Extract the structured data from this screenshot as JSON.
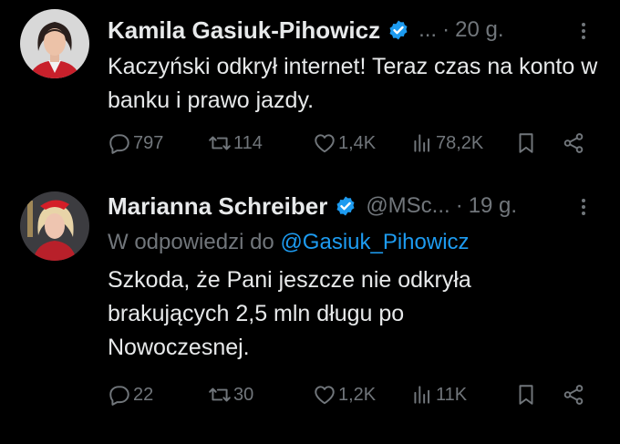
{
  "tweets": [
    {
      "author_name": "Kamila Gasiuk-Pihowicz",
      "handle": "...",
      "time": "20 g.",
      "text": "Kaczyński odkrył internet! Teraz czas na konto w banku i prawo jazdy.",
      "stats": {
        "replies": "797",
        "reposts": "114",
        "likes": "1,4K",
        "views": "78,2K"
      }
    },
    {
      "author_name": "Marianna Schreiber",
      "handle": "@MSc...",
      "time": "19 g.",
      "reply_prefix": "W odpowiedzi do",
      "reply_mention": "@Gasiuk_Pihowicz",
      "text": "Szkoda, że Pani jeszcze nie odkryła brakujących 2,5 mln długu po Nowoczesnej.",
      "stats": {
        "replies": "22",
        "reposts": "30",
        "likes": "1,2K",
        "views": "11K"
      }
    }
  ],
  "colors": {
    "background": "#000000",
    "text": "#e7e9ea",
    "muted": "#71767b",
    "link": "#1d9bf0",
    "verified": "#1d9bf0"
  }
}
